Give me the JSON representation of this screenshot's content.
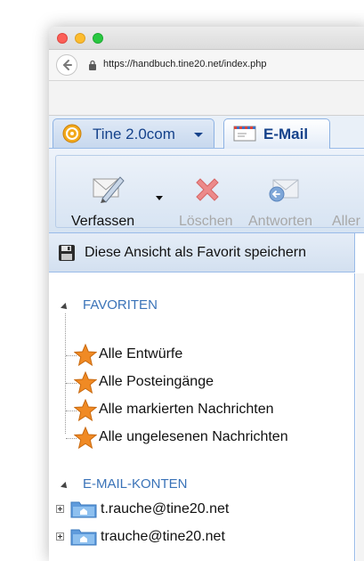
{
  "browser": {
    "url": "https://handbuch.tine20.net/index.php"
  },
  "tabs": [
    {
      "label": "Tine 2.0com",
      "icon": "tine-logo-icon"
    },
    {
      "label": "E-Mail",
      "icon": "mail-tab-icon"
    }
  ],
  "toolbar": {
    "compose_label": "Verfassen",
    "delete_label": "Löschen",
    "reply_label": "Antworten",
    "reply_all_label": "Aller"
  },
  "favorite_bar": {
    "label": "Diese Ansicht als Favorit speichern"
  },
  "tree": {
    "favorites_header": "FAVORITEN",
    "favorites": [
      {
        "label": "Alle Entwürfe"
      },
      {
        "label": "Alle Posteingänge"
      },
      {
        "label": "Alle markierten Nachrichten"
      },
      {
        "label": "Alle ungelesenen Nachrichten"
      }
    ],
    "accounts_header": "E-MAIL-KONTEN",
    "accounts": [
      {
        "label": "t.rauche@tine20.net"
      },
      {
        "label": "trauche@tine20.net"
      }
    ]
  },
  "colors": {
    "accent": "#15428b",
    "section_header": "#3a73b8",
    "disabled_text": "#a8a8a8",
    "star": "#f08a24"
  }
}
